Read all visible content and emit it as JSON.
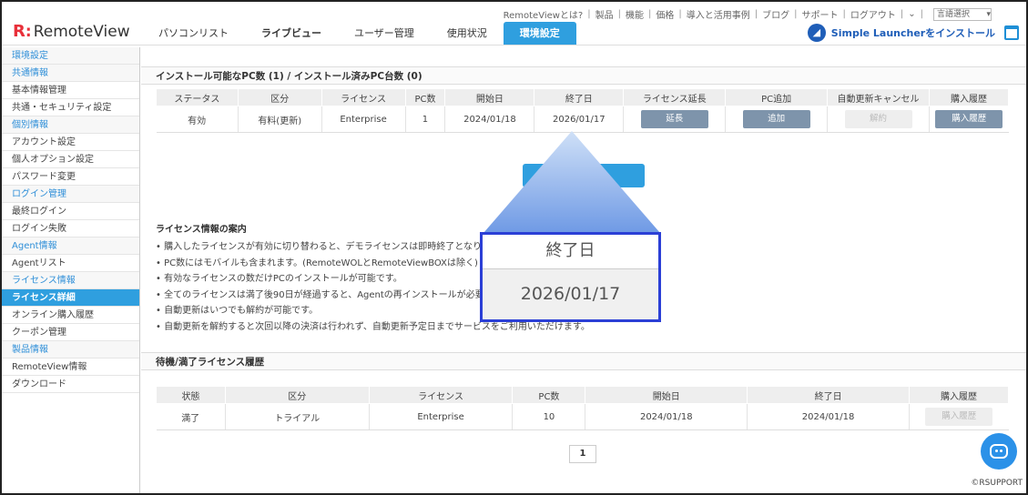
{
  "top_links": {
    "items": [
      "RemoteViewとは?",
      "製品",
      "機能",
      "価格",
      "導入と活用事例",
      "ブログ",
      "サポート",
      "ログアウト"
    ],
    "language_select": "言語選択"
  },
  "logo": {
    "mark": "R",
    "text": "RemoteView"
  },
  "nav": {
    "tabs": [
      {
        "label": "パソコンリスト"
      },
      {
        "label": "ライブビュー"
      },
      {
        "label": "ユーザー管理"
      },
      {
        "label": "使用状況"
      },
      {
        "label": "環境設定"
      }
    ]
  },
  "launcher": {
    "label": "Simple Launcherをインストール"
  },
  "sidebar": {
    "items": [
      {
        "label": "環境設定",
        "type": "cat"
      },
      {
        "label": "共通情報",
        "type": "cat"
      },
      {
        "label": "基本情報管理",
        "type": "item"
      },
      {
        "label": "共通・セキュリティ設定",
        "type": "item"
      },
      {
        "label": "個別情報",
        "type": "cat"
      },
      {
        "label": "アカウント設定",
        "type": "item"
      },
      {
        "label": "個人オプション設定",
        "type": "item"
      },
      {
        "label": "パスワード変更",
        "type": "item"
      },
      {
        "label": "ログイン管理",
        "type": "cat"
      },
      {
        "label": "最終ログイン",
        "type": "item"
      },
      {
        "label": "ログイン失敗",
        "type": "item"
      },
      {
        "label": "Agent情報",
        "type": "cat"
      },
      {
        "label": "Agentリスト",
        "type": "item"
      },
      {
        "label": "ライセンス情報",
        "type": "cat"
      },
      {
        "label": "ライセンス詳細",
        "type": "active"
      },
      {
        "label": "オンライン購入履歴",
        "type": "item"
      },
      {
        "label": "クーポン管理",
        "type": "item"
      },
      {
        "label": "製品情報",
        "type": "cat"
      },
      {
        "label": "RemoteView情報",
        "type": "item"
      },
      {
        "label": "ダウンロード",
        "type": "item"
      }
    ]
  },
  "license_section": {
    "title": "インストール可能なPC数 (1) / インストール済みPC台数 (0)",
    "headers": [
      "ステータス",
      "区分",
      "ライセンス",
      "PC数",
      "開始日",
      "終了日",
      "ライセンス延長",
      "PC追加",
      "自動更新キャンセル",
      "購入履歴"
    ],
    "row": {
      "status": "有効",
      "category": "有料(更新)",
      "license": "Enterprise",
      "pc_count": "1",
      "start": "2024/01/18",
      "end": "2026/01/17",
      "extend_btn": "延長",
      "add_btn": "追加",
      "cancel_btn": "解約",
      "history_btn": "購入履歴"
    }
  },
  "info": {
    "title": "ライセンス情報の案内",
    "items": [
      "購入したライセンスが有効に切り替わると、デモライセンスは即時終了となります。",
      "PC数にはモバイルも含まれます。(RemoteWOLとRemoteViewBOXは除く)",
      "有効なライセンスの数だけPCのインストールが可能です。",
      "全てのライセンスは満了後90日が経過すると、Agentの再インストールが必要です。",
      "自動更新はいつでも解約が可能です。",
      "自動更新を解約すると次回以降の決済は行われず、自動更新予定日までサービスをご利用いただけます。"
    ]
  },
  "history_section": {
    "title": "待機/満了ライセンス履歴",
    "headers": [
      "状態",
      "区分",
      "ライセンス",
      "PC数",
      "開始日",
      "終了日",
      "購入履歴"
    ],
    "row": {
      "state": "満了",
      "category": "トライアル",
      "license": "Enterprise",
      "pc_count": "10",
      "start": "2024/01/18",
      "end": "2024/01/18",
      "history_btn": "購入履歴"
    },
    "page": "1"
  },
  "zoom": {
    "header": "終了日",
    "value": "2026/01/17"
  },
  "copyright": "©RSUPPORT"
}
